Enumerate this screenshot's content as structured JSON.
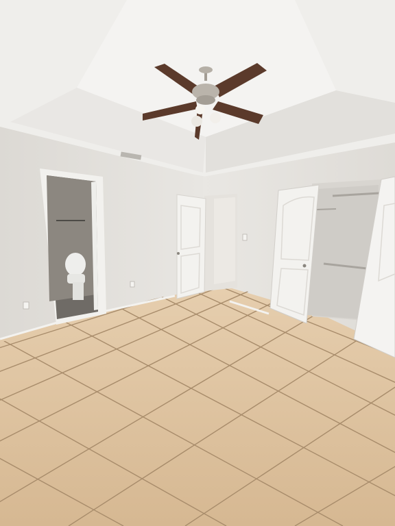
{
  "scene": {
    "description_colors": {
      "wall": "#e4e1dc",
      "wall_shadow": "#d2cec8",
      "ceiling": "#f0efec",
      "tile": "#d9bf9c",
      "grout": "#a88f70",
      "door": "#f2f1ee",
      "fan_blade": "#5a3a2c",
      "fan_metal": "#b8b2a8"
    }
  }
}
